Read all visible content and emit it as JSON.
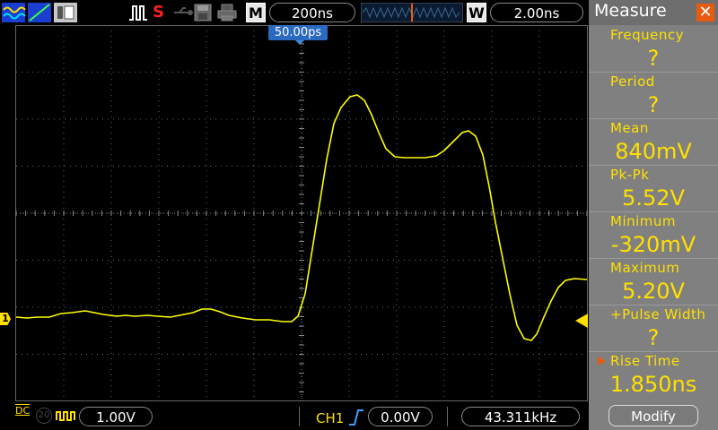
{
  "toolbar": {
    "run_indicator": "S",
    "memory_depth_letter": "M",
    "timebase": "200ns",
    "window_letter": "W",
    "window_timebase": "2.00ns"
  },
  "trigger_position_label": "50.00ps",
  "channel_marker": "1",
  "measure_panel": {
    "title": "Measure",
    "items": [
      {
        "label": "Frequency",
        "value": "?"
      },
      {
        "label": "Period",
        "value": "?"
      },
      {
        "label": "Mean",
        "value": "840mV"
      },
      {
        "label": "Pk-Pk",
        "value": "5.52V"
      },
      {
        "label": "Minimum",
        "value": "-320mV"
      },
      {
        "label": "Maximum",
        "value": "5.20V"
      },
      {
        "label": "+Pulse Width",
        "value": "?"
      },
      {
        "label": "Rise Time",
        "value": "1.850ns"
      }
    ],
    "modify_label": "Modify"
  },
  "bottom": {
    "coupling": "DC",
    "bw_limit": "20",
    "volts_div": "1.00V",
    "trigger_source": "CH1",
    "trigger_level": "0.00V",
    "frequency": "43.311kHz"
  },
  "colors": {
    "trace": "#ffff00",
    "grid": "#606060",
    "panel_bg": "#808080",
    "accent_orange": "#e85a10"
  }
}
